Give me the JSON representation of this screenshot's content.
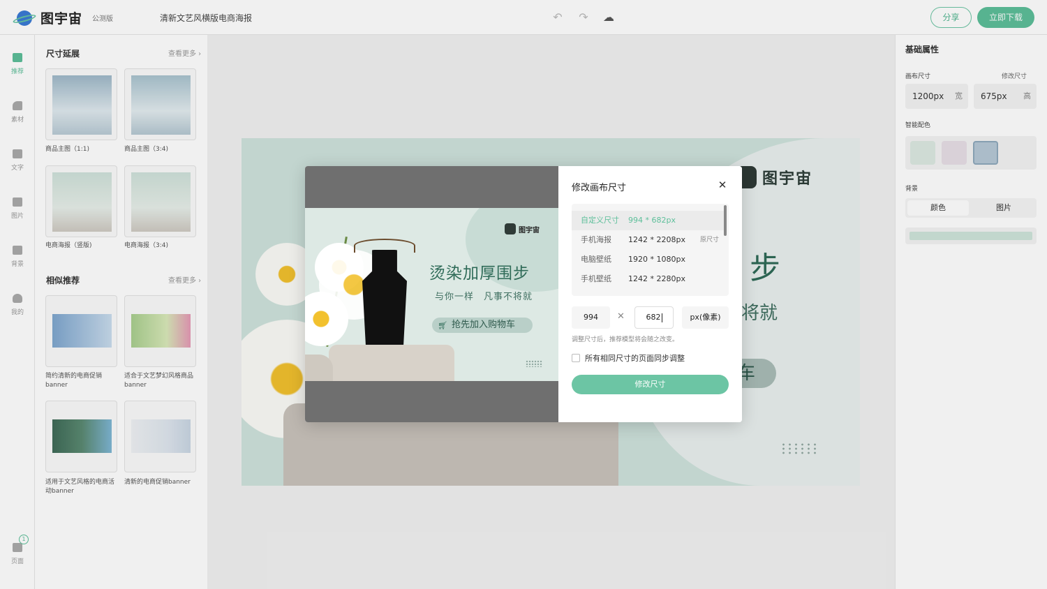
{
  "header": {
    "logo_text": "图宇宙",
    "beta_label": "公测版",
    "doc_title": "清新文艺风横版电商海报",
    "undo_icon": "undo-icon",
    "redo_icon": "redo-icon",
    "cloud_icon": "cloud-upload-icon",
    "share_label": "分享",
    "download_label": "立即下载"
  },
  "rail": {
    "items": [
      {
        "label": "推荐",
        "icon": "recommend-icon",
        "active": true
      },
      {
        "label": "素材",
        "icon": "shapes-icon"
      },
      {
        "label": "文字",
        "icon": "text-icon"
      },
      {
        "label": "图片",
        "icon": "image-icon"
      },
      {
        "label": "背景",
        "icon": "background-icon"
      },
      {
        "label": "我的",
        "icon": "user-icon"
      }
    ],
    "pages_label": "页面",
    "pages_count": "1"
  },
  "panel": {
    "section1_title": "尺寸延展",
    "section2_title": "相似推荐",
    "see_more": "查看更多",
    "size_cards": [
      {
        "caption": "商品主图（1:1)"
      },
      {
        "caption": "商品主图（3:4)"
      },
      {
        "caption": "电商海报（竖版)"
      },
      {
        "caption": "电商海报（3:4)"
      }
    ],
    "similar_cards": [
      {
        "caption": "简约清新的电商促销banner"
      },
      {
        "caption": "适合于文艺梦幻风格商品banner"
      },
      {
        "caption": "适用于文艺风格的电商活动banner"
      },
      {
        "caption": "清新的电商促销banner"
      }
    ]
  },
  "right_panel": {
    "title": "基础属性",
    "canvas_size_label": "画布尺寸",
    "modify_size_link": "修改尺寸",
    "width_value": "1200px",
    "width_unit": "宽",
    "height_value": "675px",
    "height_unit": "高",
    "smart_color_label": "智能配色",
    "swatches": [
      "#dce9e2",
      "#e7dfe6",
      "#b6c8d6"
    ],
    "background_label": "背景",
    "tab_color": "颜色",
    "tab_image": "图片"
  },
  "canvas": {
    "logo_text": "图宇宙",
    "title_fragment": "步",
    "subtitle_fragment": "将就",
    "cart_fragment": "车"
  },
  "modal": {
    "title": "修改画布尺寸",
    "close_icon": "close-icon",
    "sizes": [
      {
        "name": "自定义尺寸",
        "value": "994 * 682px",
        "note": ""
      },
      {
        "name": "手机海报",
        "value": "1242 * 2208px",
        "note": "原尺寸"
      },
      {
        "name": "电脑壁纸",
        "value": "1920 * 1080px",
        "note": ""
      },
      {
        "name": "手机壁纸",
        "value": "1242 * 2280px",
        "note": ""
      }
    ],
    "width_input": "994",
    "height_input": "682",
    "unit_label": "px(像素)",
    "hint": "调整尺寸后，推荐模型将会随之改变。",
    "sync_label": "所有相同尺寸的页面同步调整",
    "confirm_label": "修改尺寸",
    "preview": {
      "logo_text": "图宇宙",
      "title": "烫染加厚围步",
      "subtitle": "与你一样　凡事不将就",
      "button": "抢先加入购物车"
    }
  },
  "colors": {
    "accent": "#5dbf9a",
    "accent_light": "#6cc5a4"
  }
}
